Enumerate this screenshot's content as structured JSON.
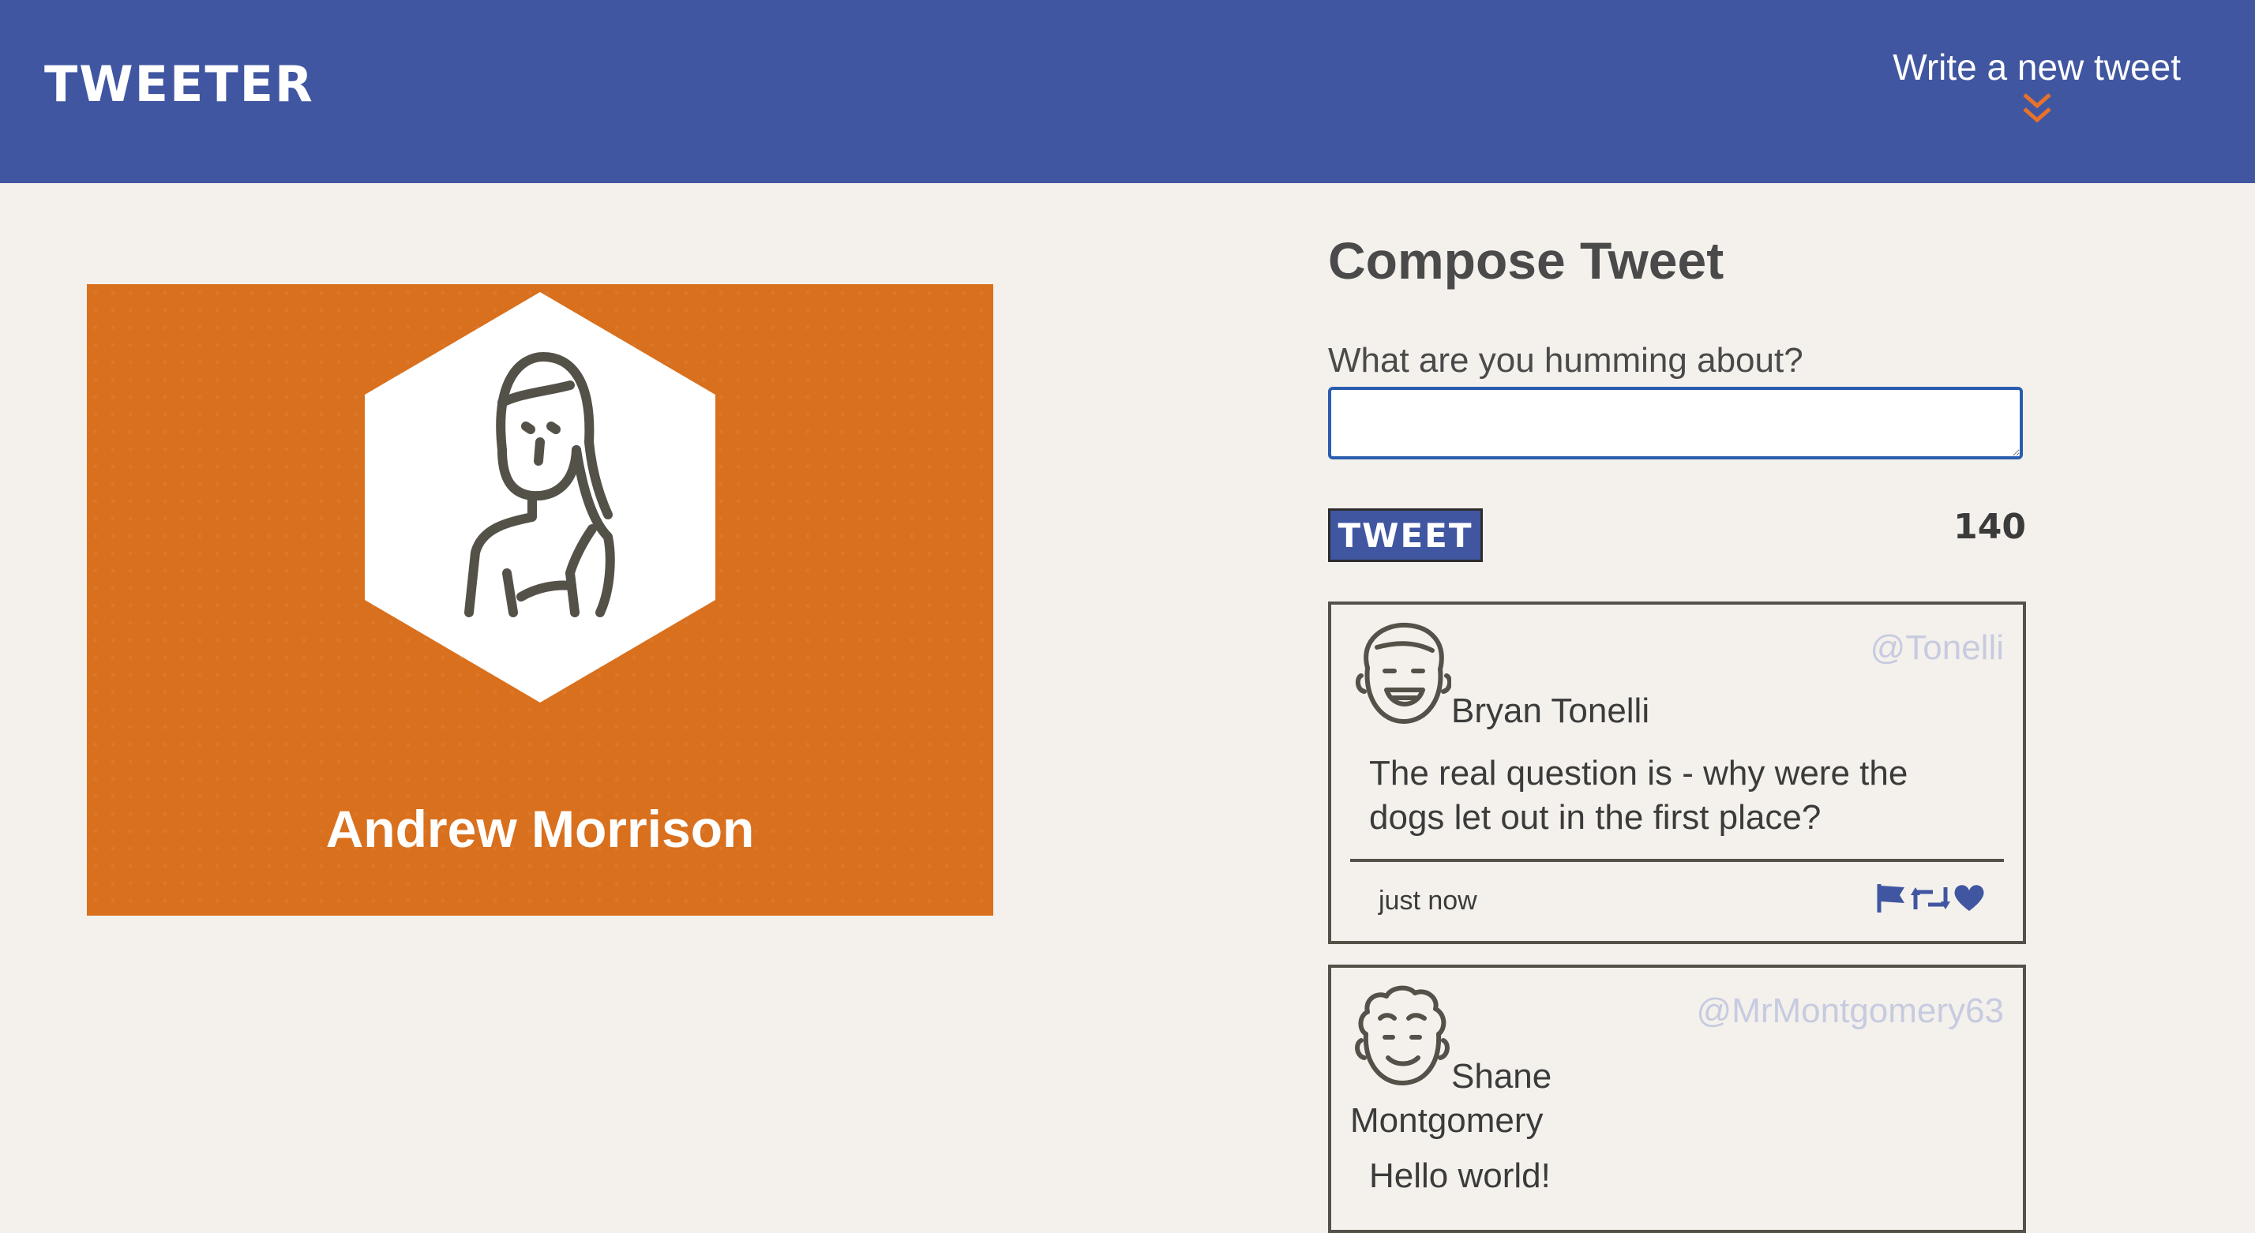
{
  "header": {
    "brand": "TWEETER",
    "new_tweet_label": "Write a new tweet",
    "chevron_icon": "double-chevron-down-icon",
    "bg_color": "#4056a1",
    "accent_color": "#e8722b"
  },
  "profile": {
    "name": "Andrew Morrison",
    "avatar_icon": "woman-avatar-icon",
    "card_color": "#d9701e"
  },
  "compose": {
    "title": "Compose Tweet",
    "label": "What are you humming about?",
    "input_value": "",
    "button_label": "TWEET",
    "char_count": "140"
  },
  "tweets": [
    {
      "avatar_icon": "smiling-man-avatar-icon",
      "author": "Bryan Tonelli",
      "handle": "@Tonelli",
      "content": "The real question is - why were the dogs let out in the first place?",
      "timestamp": "just now",
      "actions": [
        "flag-icon",
        "retweet-icon",
        "heart-icon"
      ]
    },
    {
      "avatar_icon": "curly-hair-man-avatar-icon",
      "author": "Shane Montgomery",
      "handle": "@MrMontgomery63",
      "content": "Hello world!"
    }
  ]
}
